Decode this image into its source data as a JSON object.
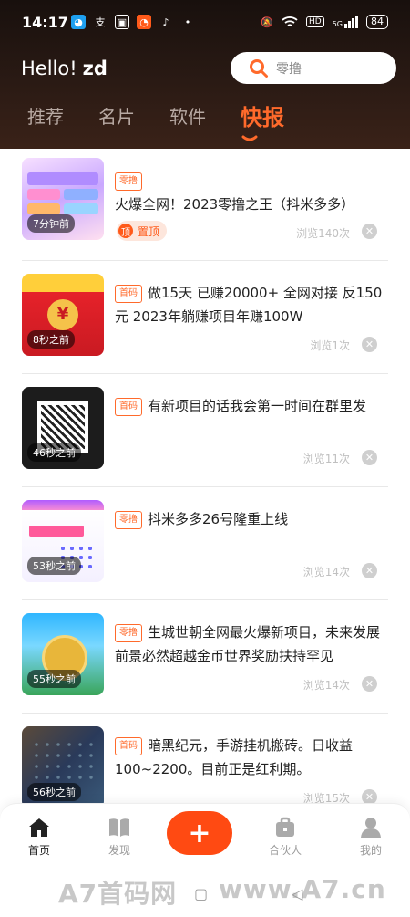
{
  "status": {
    "time": "14:17",
    "battery": "84",
    "network": "5G",
    "hd": "HD"
  },
  "header": {
    "greeting_prefix": "Hello!",
    "username": "zd",
    "search_placeholder": "零撸"
  },
  "tabs": [
    "推荐",
    "名片",
    "软件",
    "快报"
  ],
  "active_tab": "快报",
  "feed": [
    {
      "tag": "零撸",
      "title": "火爆全网！2023零撸之王（抖米多多）",
      "time_label": "7分钟前",
      "views": "浏览140次",
      "pinned": true,
      "pin_label": "置顶",
      "pin_icon": "顶"
    },
    {
      "tag": "首码",
      "title": "做15天 已赚20000+ 全网对接 反150元 2023年躺赚项目年赚100W",
      "time_label": "8秒之前",
      "views": "浏览1次"
    },
    {
      "tag": "首码",
      "title": "有新项目的话我会第一时间在群里发",
      "time_label": "46秒之前",
      "views": "浏览11次"
    },
    {
      "tag": "零撸",
      "title": "抖米多多26号隆重上线",
      "time_label": "53秒之前",
      "views": "浏览14次"
    },
    {
      "tag": "零撸",
      "title": "生城世朝全网最火爆新项目，未来发展前景必然超越金币世界奖励扶持罕见",
      "time_label": "55秒之前",
      "views": "浏览14次"
    },
    {
      "tag": "首码",
      "title": "暗黑纪元，手游挂机搬砖。日收益100~2200。目前正是红利期。",
      "time_label": "56秒之前",
      "views": "浏览15次"
    }
  ],
  "nav": {
    "home": "首页",
    "discover": "发现",
    "add": "+",
    "partner": "合伙人",
    "mine": "我的"
  },
  "watermark": {
    "left": "A7首码网",
    "right": "www.A7.cn"
  },
  "colors": {
    "accent": "#ff6a2b",
    "fab": "#ff4a12",
    "header_bg": "#1e130f"
  }
}
